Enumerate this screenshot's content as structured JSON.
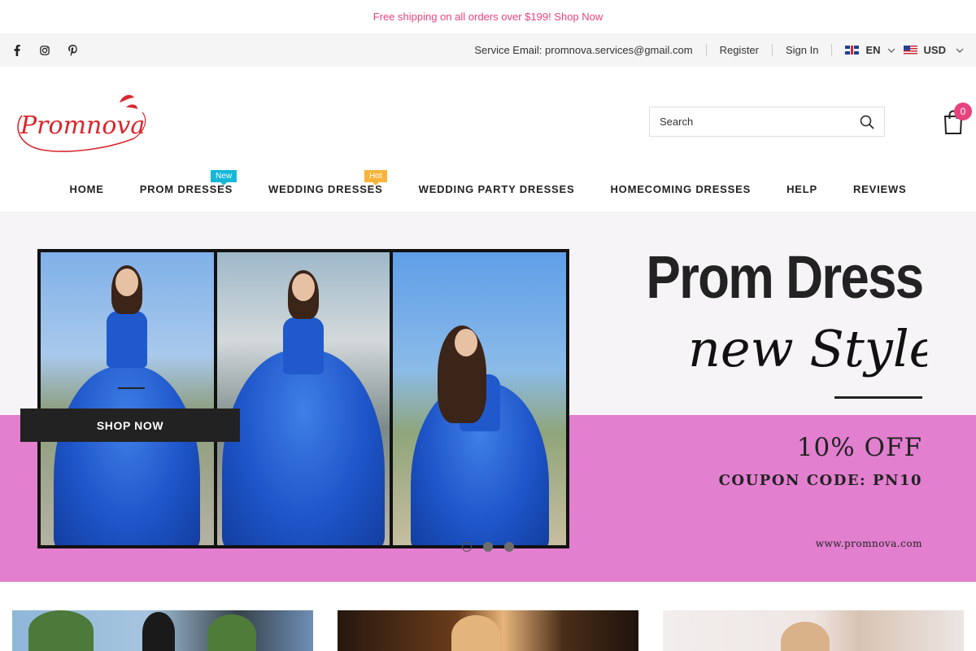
{
  "announcement": {
    "text": "Free shipping on all orders over $199! Shop Now"
  },
  "topbar": {
    "social": [
      "facebook-icon",
      "instagram-icon",
      "pinterest-icon"
    ],
    "service_email": "Service Email: promnova.services@gmail.com",
    "register": "Register",
    "sign_in": "Sign In",
    "language": "EN",
    "currency": "USD"
  },
  "header": {
    "logo_text": "Promnova",
    "search_placeholder": "Search",
    "cart_count": "0"
  },
  "nav": {
    "items": [
      {
        "label": "HOME"
      },
      {
        "label": "PROM DRESSES",
        "tag": "New"
      },
      {
        "label": "WEDDING DRESSES",
        "tag": "Hot"
      },
      {
        "label": "WEDDING PARTY DRESSES"
      },
      {
        "label": "HOMECOMING DRESSES"
      },
      {
        "label": "HELP"
      },
      {
        "label": "REVIEWS"
      }
    ]
  },
  "hero": {
    "title": "Prom Dress",
    "script": "new Style",
    "discount": "10% OFF",
    "coupon": "COUPON CODE: PN10",
    "url": "www.promnova.com",
    "cta": "SHOP NOW",
    "slides": 3,
    "active_slide": 1
  },
  "colors": {
    "accent_pink": "#e8437f",
    "hero_band": "#e27fcf",
    "new_tag": "#14b7d8",
    "hot_tag": "#f7b43a"
  }
}
